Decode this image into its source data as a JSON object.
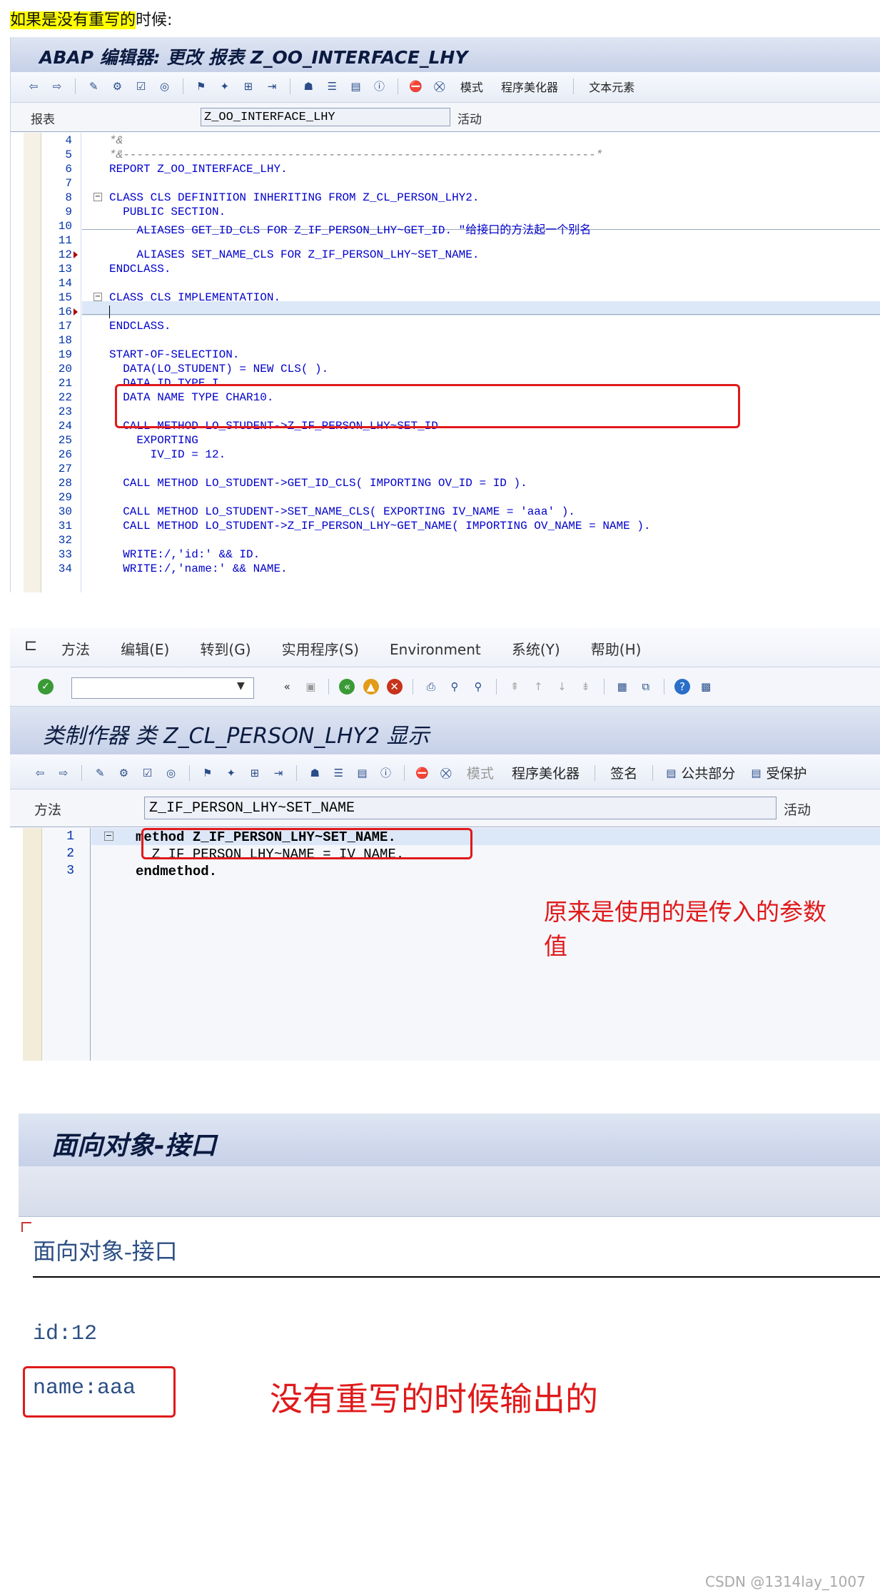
{
  "caption": {
    "hl": "如果是没有重写的",
    "rest": "时候:"
  },
  "s1": {
    "title": "ABAP 编辑器: 更改 报表 Z_OO_INTERFACE_LHY",
    "toolbar": {
      "mode": "模式",
      "pretty": "程序美化器",
      "text": "文本元素"
    },
    "field_label": "报表",
    "field_value": "Z_OO_INTERFACE_LHY",
    "status": "活动",
    "lines": [
      {
        "n": "4",
        "t": "*&"
      },
      {
        "n": "5",
        "t": "*&---------------------------------------------------------------------*"
      },
      {
        "n": "6",
        "t": "REPORT Z_OO_INTERFACE_LHY."
      },
      {
        "n": "7",
        "t": ""
      },
      {
        "n": "8",
        "t": "CLASS CLS DEFINITION INHERITING FROM Z_CL_PERSON_LHY2."
      },
      {
        "n": "9",
        "t": "  PUBLIC SECTION."
      },
      {
        "n": "10",
        "t": "    ALIASES GET_ID_CLS FOR Z_IF_PERSON_LHY~GET_ID. \"给接口的方法起一个别名"
      },
      {
        "n": "11",
        "t": ""
      },
      {
        "n": "12",
        "t": "    ALIASES SET_NAME_CLS FOR Z_IF_PERSON_LHY~SET_NAME."
      },
      {
        "n": "13",
        "t": "ENDCLASS."
      },
      {
        "n": "14",
        "t": ""
      },
      {
        "n": "15",
        "t": "CLASS CLS IMPLEMENTATION."
      },
      {
        "n": "16",
        "t": ""
      },
      {
        "n": "17",
        "t": "ENDCLASS."
      },
      {
        "n": "18",
        "t": ""
      },
      {
        "n": "19",
        "t": "START-OF-SELECTION."
      },
      {
        "n": "20",
        "t": "  DATA(LO_STUDENT) = NEW CLS( )."
      },
      {
        "n": "21",
        "t": "  DATA ID TYPE I."
      },
      {
        "n": "22",
        "t": "  DATA NAME TYPE CHAR10."
      },
      {
        "n": "23",
        "t": ""
      },
      {
        "n": "24",
        "t": "  CALL METHOD LO_STUDENT->Z_IF_PERSON_LHY~SET_ID"
      },
      {
        "n": "25",
        "t": "    EXPORTING"
      },
      {
        "n": "26",
        "t": "      IV_ID = 12."
      },
      {
        "n": "27",
        "t": ""
      },
      {
        "n": "28",
        "t": "  CALL METHOD LO_STUDENT->GET_ID_CLS( IMPORTING OV_ID = ID )."
      },
      {
        "n": "29",
        "t": ""
      },
      {
        "n": "30",
        "t": "  CALL METHOD LO_STUDENT->SET_NAME_CLS( EXPORTING IV_NAME = 'aaa' )."
      },
      {
        "n": "31",
        "t": "  CALL METHOD LO_STUDENT->Z_IF_PERSON_LHY~GET_NAME( IMPORTING OV_NAME = NAME )."
      },
      {
        "n": "32",
        "t": ""
      },
      {
        "n": "33",
        "t": "  WRITE:/,'id:' && ID."
      },
      {
        "n": "34",
        "t": "  WRITE:/,'name:' && NAME."
      }
    ]
  },
  "s2": {
    "menu": [
      "方法",
      "编辑(E)",
      "转到(G)",
      "实用程序(S)",
      "Environment",
      "系统(Y)",
      "帮助(H)"
    ],
    "title": "类制作器 类 Z_CL_PERSON_LHY2 显示",
    "toolbar": {
      "mode": "模式",
      "pretty": "程序美化器",
      "sign": "签名",
      "public": "公共部分",
      "protected": "受保护"
    },
    "field_label": "方法",
    "field_value": "Z_IF_PERSON_LHY~SET_NAME",
    "status": "活动",
    "lines": [
      {
        "n": "1",
        "t": "method Z_IF_PERSON_LHY~SET_NAME."
      },
      {
        "n": "2",
        "t": "  Z_IF_PERSON_LHY~NAME = IV_NAME."
      },
      {
        "n": "3",
        "t": "endmethod."
      }
    ],
    "annotation": "原来是使用的是传入的参数值"
  },
  "s3": {
    "title": "面向对象-接口",
    "heading": "面向对象-接口",
    "out1": "id:12",
    "out2": "name:aaa",
    "annotation": "没有重写的时候输出的"
  },
  "watermark": "CSDN @1314lay_1007"
}
